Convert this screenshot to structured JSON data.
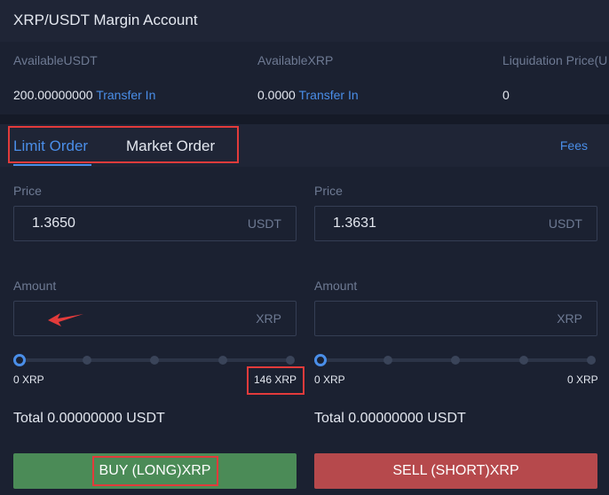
{
  "account": {
    "title": "XRP/USDT Margin Account"
  },
  "stats": [
    {
      "label": "AvailableUSDT",
      "value": "200.00000000",
      "link": "Transfer In"
    },
    {
      "label": "AvailableXRP",
      "value": "0.0000",
      "link": "Transfer In"
    },
    {
      "label": "Liquidation Price(U",
      "value": "0"
    }
  ],
  "tabs": {
    "limit": "Limit Order",
    "market": "Market Order",
    "fees": "Fees"
  },
  "buy": {
    "price_label": "Price",
    "price_value": "1.3650",
    "price_unit": "USDT",
    "amount_label": "Amount",
    "amount_value": "",
    "amount_unit": "XRP",
    "slider_level": 0,
    "range_min": "0 XRP",
    "range_max": "146 XRP",
    "total": "Total 0.00000000 USDT",
    "button": "BUY (LONG)XRP"
  },
  "sell": {
    "price_label": "Price",
    "price_value": "1.3631",
    "price_unit": "USDT",
    "amount_label": "Amount",
    "amount_value": "",
    "amount_unit": "XRP",
    "slider_level": 0,
    "range_min": "0 XRP",
    "range_max": "0 XRP",
    "total": "Total 0.00000000 USDT",
    "button": "SELL (SHORT)XRP"
  },
  "colors": {
    "accent": "#4a8ee8",
    "buy": "#4b8b57",
    "sell": "#b6494c",
    "highlight": "#e23b3b"
  }
}
